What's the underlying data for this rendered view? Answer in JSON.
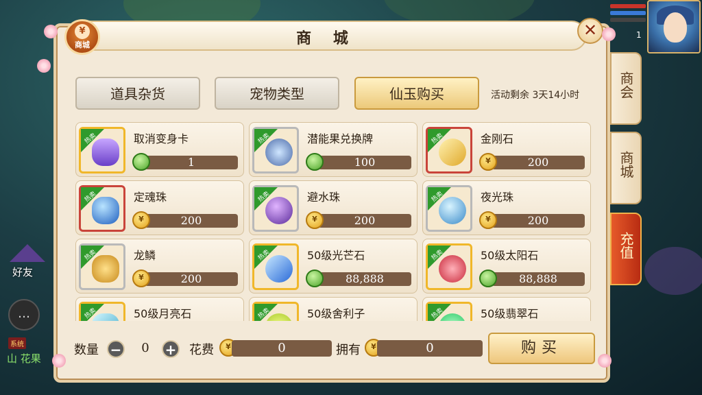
{
  "window": {
    "title": "商 城",
    "badge_label": "商城",
    "badge_icon": "¥",
    "close_glyph": "✕"
  },
  "tabs": [
    {
      "label": "道具杂货",
      "active": false
    },
    {
      "label": "宠物类型",
      "active": false
    },
    {
      "label": "仙玉购买",
      "active": true
    }
  ],
  "timer": "活动剩余 3天14小时",
  "side_tabs": [
    {
      "label": "商会"
    },
    {
      "label": "商城"
    },
    {
      "label": "充值"
    }
  ],
  "hud": {
    "number": "1"
  },
  "left": {
    "friend_label": "好友",
    "chat_tag": "系统",
    "chat_text": "山 花果"
  },
  "hot_label": "热卖",
  "items": [
    {
      "name": "取消变身卡",
      "price": "1",
      "currency": "jade-icon",
      "frame": "gold"
    },
    {
      "name": "潜能果兑换牌",
      "price": "100",
      "currency": "jade-icon",
      "frame": "silver"
    },
    {
      "name": "金刚石",
      "price": "200",
      "currency": "gold-coin-icon",
      "frame": "red"
    },
    {
      "name": "定魂珠",
      "price": "200",
      "currency": "gold-coin-icon",
      "frame": "red"
    },
    {
      "name": "避水珠",
      "price": "200",
      "currency": "gold-coin-icon",
      "frame": "silver"
    },
    {
      "name": "夜光珠",
      "price": "200",
      "currency": "gold-coin-icon",
      "frame": "silver"
    },
    {
      "name": "龙鳞",
      "price": "200",
      "currency": "gold-coin-icon",
      "frame": "silver"
    },
    {
      "name": "50级光芒石",
      "price": "88,888",
      "currency": "jade-icon",
      "frame": "gold"
    },
    {
      "name": "50级太阳石",
      "price": "88,888",
      "currency": "jade-icon",
      "frame": "gold"
    },
    {
      "name": "50级月亮石",
      "price": "",
      "currency": "jade-icon",
      "frame": "gold"
    },
    {
      "name": "50级舍利子",
      "price": "",
      "currency": "jade-icon",
      "frame": "gold"
    },
    {
      "name": "50级翡翠石",
      "price": "",
      "currency": "jade-icon",
      "frame": "gold"
    }
  ],
  "bottom": {
    "qty_label": "数量",
    "qty_value": "0",
    "minus": "−",
    "plus": "+",
    "cost_label": "花费",
    "cost_value": "0",
    "own_label": "拥有",
    "own_value": "0",
    "buy_label": "购买"
  },
  "colors": {
    "hot": "#2f9a2c",
    "gold_frame": "#f0b72a",
    "price_bar": "#7a5b43",
    "recharge": "#d0431c"
  }
}
